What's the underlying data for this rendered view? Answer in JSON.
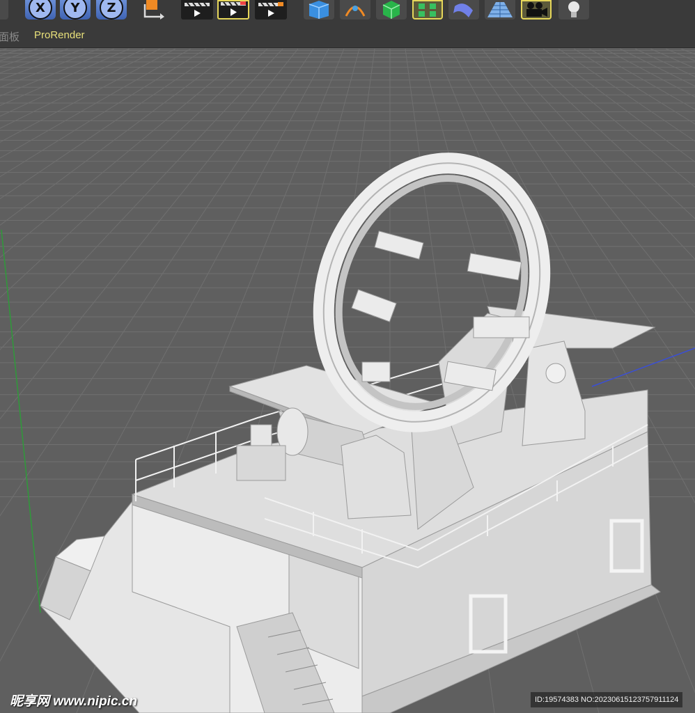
{
  "toolbar": {
    "axis_buttons": [
      {
        "label": "X",
        "icon": "x-axis-lock-icon"
      },
      {
        "label": "Y",
        "icon": "y-axis-lock-icon"
      },
      {
        "label": "Z",
        "icon": "z-axis-lock-icon"
      }
    ],
    "render_buttons": [
      "render-view-icon",
      "render-picture-viewer-icon",
      "render-settings-icon"
    ],
    "object_buttons": [
      "cube-icon",
      "spline-pen-icon",
      "subdivision-icon",
      "cloner-icon",
      "deformer-icon",
      "floor-icon",
      "camera-icon",
      "light-icon"
    ],
    "colors": {
      "highlight": "#e6d75a",
      "axis_blue": "#5a7fd0"
    }
  },
  "menu": {
    "items": [
      "面板",
      "ProRender"
    ],
    "colors": {
      "faded": "#8a8a8a",
      "highlight": "#e8e07a"
    }
  },
  "viewport": {
    "background": "#5f5f5f",
    "grid_color": "#6e6e6e",
    "axis_colors": {
      "y": "#2f9a3a",
      "z": "#3a4fd8"
    },
    "model_color": "#e6e6e6"
  },
  "watermark": {
    "left": "昵享网 www.nipic.cn",
    "right": "ID:19574383 NO:20230615123757911124"
  }
}
